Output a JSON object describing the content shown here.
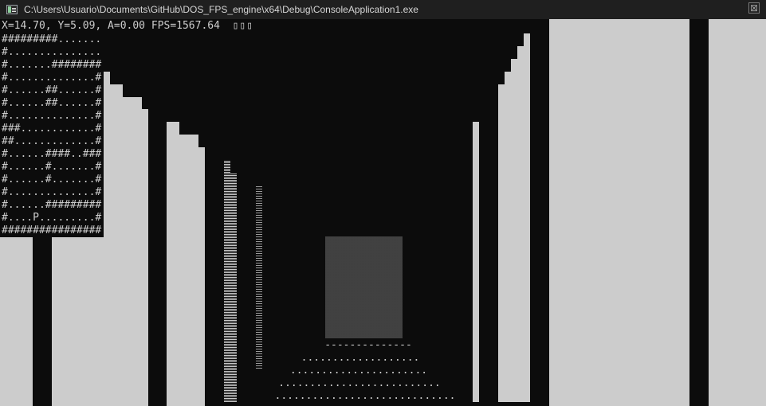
{
  "window": {
    "title": "C:\\Users\\Usuario\\Documents\\GitHub\\DOS_FPS_engine\\x64\\Debug\\ConsoleApplication1.exe",
    "icon": "console-app-icon",
    "close_glyph": "⊠"
  },
  "hud": {
    "status": "X=14.70, Y=5.09, A=0.00 FPS=1567.64",
    "glyphs": "▯▯▯"
  },
  "minimap": {
    "rows": [
      "#########.......",
      "#...............",
      "#.......########",
      "#..............#",
      "#......##......#",
      "#......##......#",
      "#..............#",
      "###............#",
      "##.............#",
      "#......####..###",
      "#......#.......#",
      "#......#.......#",
      "#..............#",
      "#......#########",
      "#....P.........#",
      "################"
    ]
  },
  "floor": {
    "rows": [
      "--------------",
      "...................",
      "......................",
      "..........................",
      "............................."
    ]
  },
  "colors": {
    "background": "#0c0c0c",
    "wall": "#cccccc",
    "titlebar": "#1f1f1f"
  }
}
